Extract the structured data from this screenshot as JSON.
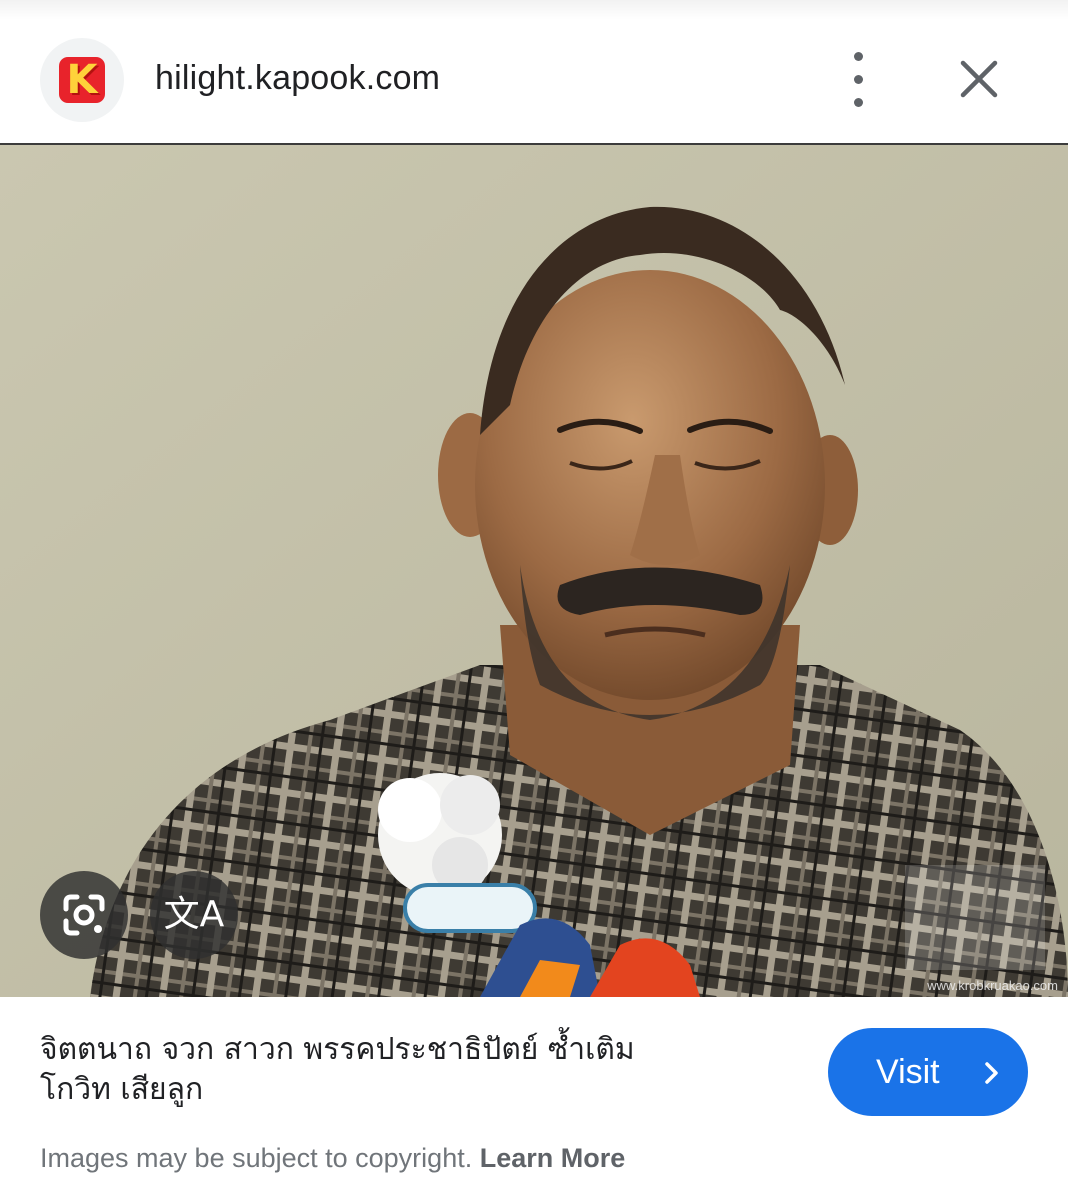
{
  "header": {
    "favicon_letter": "K",
    "domain": "hilight.kapook.com",
    "more_icon": "more-vert-icon",
    "close_icon": "close-icon"
  },
  "image": {
    "watermark_text": "www.krobkruakao.com",
    "overlay_buttons": {
      "lens_icon": "google-lens-icon",
      "translate_icon": "translate-icon",
      "translate_glyph": "文A"
    }
  },
  "caption": {
    "title_line1": "จิตตนาถ จวก สาวก พรรคประชาธิปัตย์ ซ้ำเติม",
    "title_line2": "โกวิท เสียลูก",
    "visit_label": "Visit",
    "visit_icon": "chevron-right-icon"
  },
  "footer": {
    "copyright_text": "Images may be subject to copyright.",
    "learn_more": "Learn More"
  },
  "colors": {
    "accent": "#1a73e8",
    "brand_red": "#e8232b",
    "brand_yellow": "#ffd23a",
    "overlay_button": "#303030"
  }
}
